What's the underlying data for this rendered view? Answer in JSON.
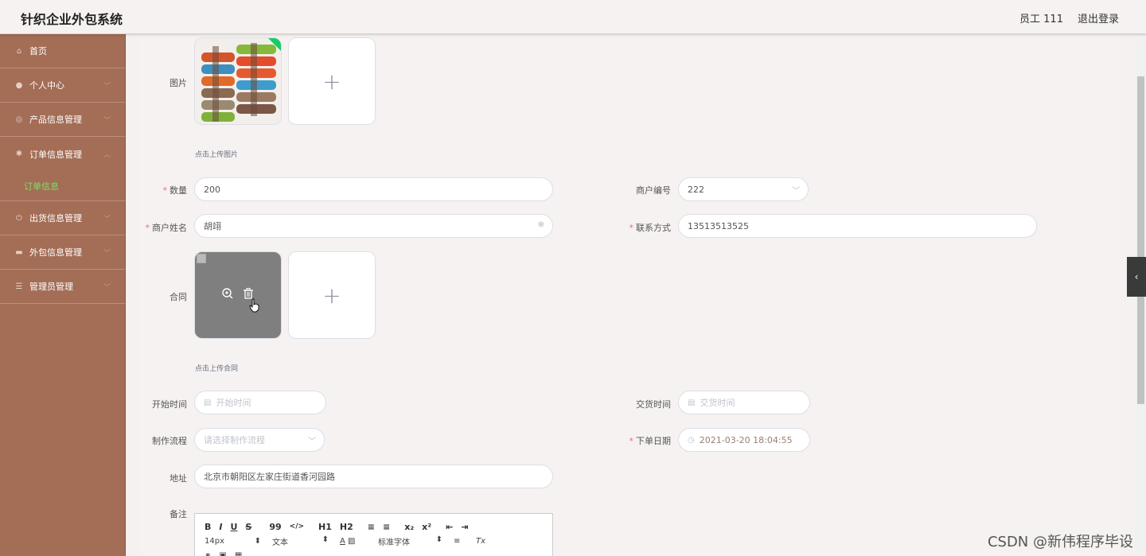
{
  "header": {
    "title": "针织企业外包系统",
    "user": "员工 111",
    "logout": "退出登录"
  },
  "sidebar": {
    "items": [
      {
        "label": "首页",
        "icon": "home-icon"
      },
      {
        "label": "个人中心",
        "icon": "user-icon"
      },
      {
        "label": "产品信息管理",
        "icon": "product-icon"
      },
      {
        "label": "订单信息管理",
        "icon": "order-icon"
      },
      {
        "label": "订单信息",
        "sub": true
      },
      {
        "label": "出货信息管理",
        "icon": "shipping-icon"
      },
      {
        "label": "外包信息管理",
        "icon": "outsource-icon"
      },
      {
        "label": "管理员管理",
        "icon": "admin-icon"
      }
    ]
  },
  "form": {
    "image_label": "图片",
    "image_hint": "点击上传图片",
    "quantity_label": "数量",
    "quantity_value": "200",
    "merchant_no_label": "商户编号",
    "merchant_no_value": "222",
    "merchant_name_label": "商户姓名",
    "merchant_name_value": "胡翊",
    "contact_label": "联系方式",
    "contact_value": "13513513525",
    "contract_label": "合同",
    "contract_hint": "点击上传合同",
    "start_label": "开始时间",
    "start_placeholder": "开始时间",
    "delivery_label": "交货时间",
    "delivery_placeholder": "交货时间",
    "process_label": "制作流程",
    "process_placeholder": "请选择制作流程",
    "order_date_label": "下单日期",
    "order_date_value": "2021-03-20 18:04:55",
    "address_label": "地址",
    "address_value": "北京市朝阳区左家庄街道香河园路",
    "remark_label": "备注"
  },
  "editor": {
    "row1": [
      "B",
      "I",
      "U",
      "S",
      "99",
      "</>",
      "H1",
      "H2",
      "≡",
      "≡",
      "x₂",
      "x²",
      "⇤",
      "⇥"
    ],
    "font_size": "14px",
    "text_type": "文本",
    "font_family": "标准字体"
  },
  "watermark": "CSDN @新伟程序毕设"
}
